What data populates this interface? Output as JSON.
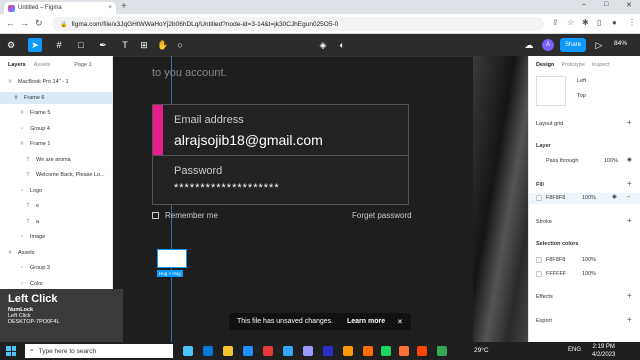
{
  "browser": {
    "tab_title": "Untitled – Figma",
    "tab_close": "×",
    "new_tab": "+",
    "url": "figma.com/file/x3JqGHtWWaHoYj2b06hDLq/Untitled?node-id=3-14&t=jk30CJhEgun025O5-0",
    "win_minimize": "–",
    "win_maximize": "□",
    "win_close": "✕"
  },
  "figma_toolbar": {
    "share_label": "Share",
    "avatar_initial": "A",
    "zoom": "84%"
  },
  "left_panel": {
    "tabs": [
      "Layers",
      "Assets",
      "Page 1"
    ],
    "layers": [
      {
        "label": "MacBook Pro 14\" - 1",
        "icon": "#",
        "indent": 0,
        "selected": false
      },
      {
        "label": "Frame 6",
        "icon": "⋕",
        "indent": 1,
        "selected": true
      },
      {
        "label": "Frame 5",
        "icon": "#",
        "indent": 2,
        "selected": false
      },
      {
        "label": "Group 4",
        "icon": "▫",
        "indent": 2,
        "selected": false
      },
      {
        "label": "Frame 1",
        "icon": "#",
        "indent": 2,
        "selected": false
      },
      {
        "label": "We are aroma",
        "icon": "T",
        "indent": 3,
        "selected": false
      },
      {
        "label": "Welcome Back, Please Lo...",
        "icon": "T",
        "indent": 3,
        "selected": false
      },
      {
        "label": "Logo",
        "icon": "▫",
        "indent": 2,
        "selected": false
      },
      {
        "label": "e",
        "icon": "T",
        "indent": 3,
        "selected": false
      },
      {
        "label": "a",
        "icon": "T",
        "indent": 3,
        "selected": false
      },
      {
        "label": "Image",
        "icon": "▫",
        "indent": 2,
        "selected": false
      },
      {
        "label": "Assets",
        "icon": "#",
        "indent": 0,
        "selected": false
      },
      {
        "label": "Group 3",
        "icon": "▫",
        "indent": 2,
        "selected": false
      },
      {
        "label": "Color",
        "icon": "○",
        "indent": 2,
        "selected": false
      }
    ]
  },
  "canvas": {
    "intro_text": "to you account.",
    "email_label": "Email address",
    "email_value": "alrajsojib18@gmail.com",
    "password_label": "Password",
    "password_value": "********************",
    "remember_label": "Remember me",
    "forgot_label": "Forget password",
    "hug_badge": "Hug × Hug"
  },
  "toast": {
    "message": "This file has unsaved changes.",
    "action": "Learn more",
    "close": "✕"
  },
  "left_click_overlay": {
    "title": "Left Click",
    "line1": "NumLock",
    "line2": "Left Click",
    "line3": "DESKTOP-7PO0F4L"
  },
  "right_panel": {
    "tabs": [
      "Design",
      "Prototype",
      "Inspect"
    ],
    "constraint_h": "Left",
    "constraint_v": "Top",
    "layout_grid": "Layout grid",
    "layer": "Layer",
    "pass_through": "Pass through",
    "layer_opacity": "100%",
    "fill": "Fill",
    "fill_hex": "F8F8F8",
    "fill_opacity": "100%",
    "stroke": "Stroke",
    "selection_colors": "Selection colors",
    "sel_color1_hex": "F8F8F8",
    "sel_color1_opacity": "100%",
    "sel_color2_hex": "FFFFFF",
    "sel_color2_opacity": "100%",
    "effects": "Effects",
    "export": "Export"
  },
  "taskbar": {
    "search_placeholder": "Type here to search",
    "weather": "29°C",
    "lang": "ENG",
    "time": "2:19 PM",
    "date": "4/2/2023"
  }
}
